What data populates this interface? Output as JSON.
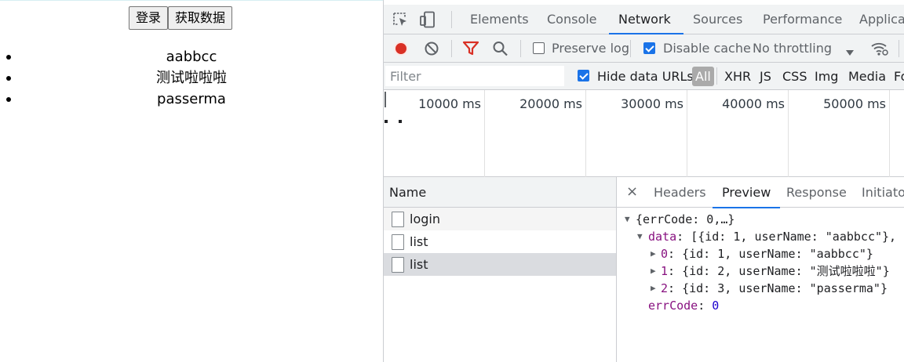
{
  "page": {
    "buttons": {
      "login": "登录",
      "fetch": "获取数据"
    },
    "list": [
      "aabbcc",
      "测试啦啦啦",
      "passerma"
    ]
  },
  "devtools": {
    "tabs": [
      "Elements",
      "Console",
      "Network",
      "Sources",
      "Performance",
      "Applicat"
    ],
    "active_tab": "Network",
    "toolbar": {
      "preserve_log": "Preserve log",
      "preserve_log_checked": false,
      "disable_cache": "Disable cache",
      "disable_cache_checked": true,
      "throttling": "No throttling"
    },
    "filter": {
      "placeholder": "Filter",
      "hide_data_urls": "Hide data URLs",
      "hide_data_urls_checked": true,
      "types": [
        "All",
        "XHR",
        "JS",
        "CSS",
        "Img",
        "Media",
        "Fo"
      ],
      "active_type": "All"
    },
    "timeline_ticks": [
      "10000 ms",
      "20000 ms",
      "30000 ms",
      "40000 ms",
      "50000 ms"
    ],
    "requests": {
      "header": "Name",
      "rows": [
        "login",
        "list",
        "list"
      ],
      "selected_index": 2
    },
    "detail": {
      "close": "×",
      "tabs": [
        "Headers",
        "Preview",
        "Response",
        "Initiator"
      ],
      "active_tab": "Preview",
      "preview": {
        "root": "{errCode: 0,…}",
        "data_key": "data",
        "data_summary": "[{id: 1, userName: \"aabbcc\"},",
        "items": [
          {
            "index": "0",
            "value": "{id: 1, userName: \"aabbcc\"}"
          },
          {
            "index": "1",
            "value": "{id: 2, userName: \"测试啦啦啦\"}"
          },
          {
            "index": "2",
            "value": "{id: 3, userName: \"passerma\"}"
          }
        ],
        "errcode_key": "errCode",
        "errcode_value": "0"
      }
    },
    "colors": {
      "accent": "#1a73e8",
      "record": "#d93025",
      "filter_icon": "#d93025"
    }
  }
}
